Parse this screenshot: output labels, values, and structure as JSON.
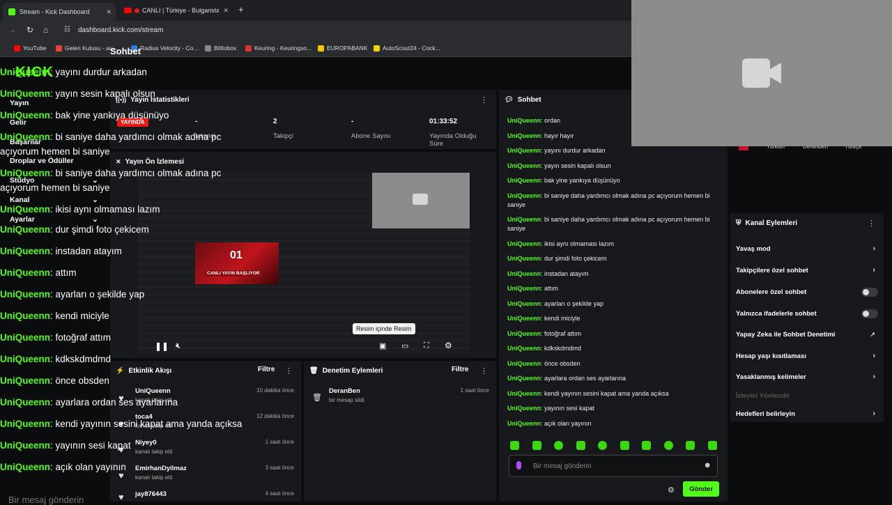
{
  "browser": {
    "tabs": [
      {
        "label": "Stream - Kick Dashboard",
        "active": true
      },
      {
        "label": "CANLI | Türkiye - Bulgarista...",
        "active": false
      }
    ],
    "url": "dashboard.kick.com/stream",
    "bookmarks": [
      "YouTube",
      "Gelen Kutusu - au...",
      "Radius Velocity - Co...",
      "Billtobox",
      "Keuring - Keuringso...",
      "EUROPABANK",
      "AutoScout24 - Cock..."
    ]
  },
  "colors": {
    "accent": "#53fc18",
    "live": "#e91916",
    "panel": "#17181b",
    "background": "#0b0c0d"
  },
  "overlay": {
    "title": "Sohbet",
    "lines": [
      {
        "user": "UniQueenn",
        "text": ": yayını durdur arkadan"
      },
      {
        "user": "UniQueenn",
        "text": ": yayın sesin kapalı olsun"
      },
      {
        "user": "UniQueenn",
        "text": ": bak yine yankıya düşünüyo"
      },
      {
        "user": "UniQueenn",
        "text": ": bi saniye daha yardımcı olmak adına pc"
      },
      {
        "user": "",
        "text": "açıyorum hemen bi saniye"
      },
      {
        "user": "UniQueenn",
        "text": ": bi saniye daha yardımcı olmak adına pc"
      },
      {
        "user": "",
        "text": "açıyorum hemen bi saniye"
      },
      {
        "user": "UniQueenn",
        "text": ": ikisi aynı olmaması lazım"
      },
      {
        "user": "UniQueenn",
        "text": ": dur şimdi foto çekicem"
      },
      {
        "user": "UniQueenn",
        "text": ": instadan atayım"
      },
      {
        "user": "UniQueenn",
        "text": ": attım"
      },
      {
        "user": "UniQueenn",
        "text": ": ayarları o şekilde yap"
      },
      {
        "user": "UniQueenn",
        "text": ": kendi miciyle"
      },
      {
        "user": "UniQueenn",
        "text": ": fotoğraf attım"
      },
      {
        "user": "UniQueenn",
        "text": ": kdkskdmdmd"
      },
      {
        "user": "UniQueenn",
        "text": ": önce obsden"
      },
      {
        "user": "UniQueenn",
        "text": ": ayarlara ordan ses ayarlarına"
      },
      {
        "user": "UniQueenn",
        "text": ": kendi yayının sesini kapat ama yanda açıksa"
      },
      {
        "user": "UniQueenn",
        "text": ": yayının sesi kapat"
      },
      {
        "user": "UniQueenn",
        "text": ": açık olan yayının"
      }
    ],
    "input_placeholder": "Bir mesaj gönderin"
  },
  "sidebar": {
    "logo": "KICK",
    "items": [
      "Yayın",
      "Gelir",
      "Başarılar",
      "Droplar ve Ödüller",
      "Stüdyo",
      "Kanal",
      "Ayarlar"
    ]
  },
  "stats": {
    "title": "Yayın İstatistikleri",
    "live_badge": "YAYINDA",
    "items": [
      {
        "value": "-",
        "label": "İzleyici"
      },
      {
        "value": "2",
        "label": "Takipçi"
      },
      {
        "value": "-",
        "label": "Abone Sayısı"
      },
      {
        "value": "01:33:52",
        "label": "Yayında Olduğu Süre"
      }
    ]
  },
  "preview": {
    "title": "Yayın Ön İzlemesi",
    "tooltip": "Resim içinde Resim",
    "inner_text": "CANLI YAYIN BAŞLIYOR",
    "inner_number": "01"
  },
  "activity": {
    "title": "Etkinlik Akışı",
    "filter": "Filtre",
    "items": [
      {
        "name": "UniQueenn",
        "sub": "kanalı takip etti",
        "time": "10 dakika önce"
      },
      {
        "name": "toca4",
        "sub": "kanalı takip etti",
        "time": "12 dakika önce"
      },
      {
        "name": "Niyey0",
        "sub": "kanalı takip etti",
        "time": "1 saat önce"
      },
      {
        "name": "EmirhanDyilmaz",
        "sub": "kanalı takip etti",
        "time": "3 saat önce"
      },
      {
        "name": "jay876443",
        "sub": "",
        "time": "4 saat önce"
      }
    ]
  },
  "moderation": {
    "title": "Denetim Eylemleri",
    "filter": "Filtre",
    "items": [
      {
        "name": "DeranBen",
        "sub": "bir mesajı sildi",
        "time": "1 saat önce"
      }
    ]
  },
  "chat": {
    "title": "Sohbet",
    "lines": [
      {
        "user": "UniQueenn",
        "text": ": ordan"
      },
      {
        "user": "UniQueenn",
        "text": ": hayır hayır"
      },
      {
        "user": "UniQueenn",
        "text": ": yayını durdur arkadan"
      },
      {
        "user": "UniQueenn",
        "text": ": yayın sesin kapalı olsun"
      },
      {
        "user": "UniQueenn",
        "text": ": bak yine yankıya düşünüyo"
      },
      {
        "user": "UniQueenn",
        "text": ": bi saniye daha yardımcı olmak adına pc açıyorum hemen bi saniye"
      },
      {
        "user": "UniQueenn",
        "text": ": bi saniye daha yardımcı olmak adına pc açıyorum hemen bi saniye"
      },
      {
        "user": "UniQueenn",
        "text": ": ikisi aynı olmaması lazım"
      },
      {
        "user": "UniQueenn",
        "text": ": dur şimdi foto çekicem"
      },
      {
        "user": "UniQueenn",
        "text": ": instadan atayım"
      },
      {
        "user": "UniQueenn",
        "text": ": attım"
      },
      {
        "user": "UniQueenn",
        "text": ": ayarları o şekilde yap"
      },
      {
        "user": "UniQueenn",
        "text": ": kendi miciyle"
      },
      {
        "user": "UniQueenn",
        "text": ": fotoğraf attım"
      },
      {
        "user": "UniQueenn",
        "text": ": kdkskdmdmd"
      },
      {
        "user": "UniQueenn",
        "text": ": önce obsden"
      },
      {
        "user": "UniQueenn",
        "text": ": ayarlara ordan ses ayarlarına"
      },
      {
        "user": "UniQueenn",
        "text": ": kendi yayının sesini kapat ama yanda açıksa"
      },
      {
        "user": "UniQueenn",
        "text": ": yayının sesi kapat"
      },
      {
        "user": "UniQueenn",
        "text": ": açık olan yayının"
      }
    ],
    "input_placeholder": "Bir mesaj gönderin",
    "send_label": "Gönder"
  },
  "tags": [
    "Turkish",
    "DeranBen",
    "Türkçe"
  ],
  "channel_actions": {
    "title": "Kanal Eylemleri",
    "items": [
      {
        "label": "Yavaş mod",
        "control": "chevron"
      },
      {
        "label": "Takipçilere özel sohbet",
        "control": "chevron"
      },
      {
        "label": "Abonelere özel sohbet",
        "control": "toggle"
      },
      {
        "label": "Yalnızca ifadelerle sohbet",
        "control": "toggle"
      },
      {
        "label": "Yapay Zeka ile Sohbet Denetimi",
        "control": "external"
      },
      {
        "label": "Hesap yaşı kısıtlaması",
        "control": "chevron"
      },
      {
        "label": "Yasaklanmış kelimeler",
        "control": "chevron"
      },
      {
        "label": "İzleyici Yönlendir",
        "control": "disabled"
      },
      {
        "label": "Hedefleri belirleyin",
        "control": "chevron"
      }
    ]
  }
}
